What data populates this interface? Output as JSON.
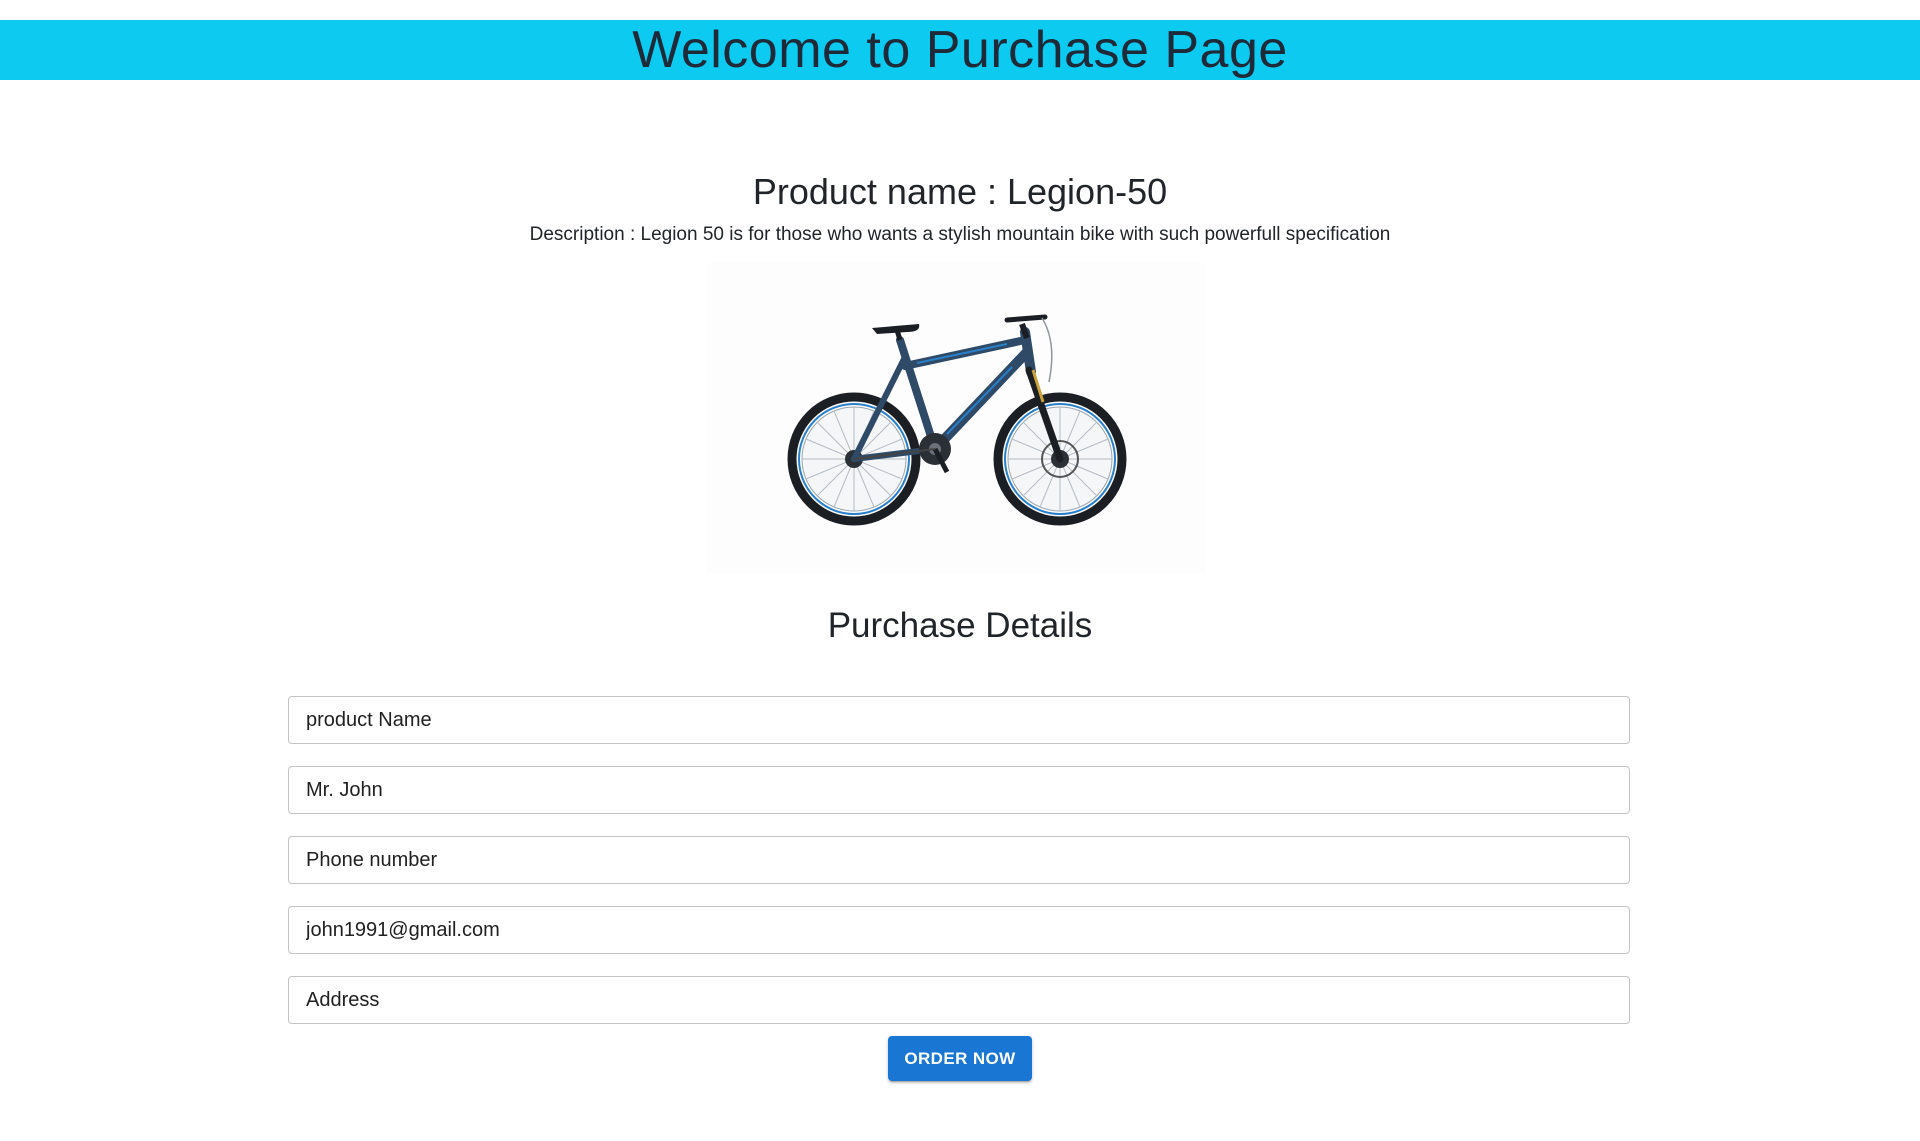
{
  "header": {
    "title": "Welcome to Purchase Page",
    "background_color": "#0dcaf0"
  },
  "product": {
    "name_line": "Product name : Legion-50",
    "description": "Description : Legion 50 is for those who wants a stylish mountain bike with such powerfull specification",
    "image_icon": "mountain-bike-image"
  },
  "form": {
    "title": "Purchase Details",
    "fields": [
      {
        "placeholder": "product Name",
        "value": ""
      },
      {
        "placeholder": "",
        "value": "Mr. John"
      },
      {
        "placeholder": "Phone number",
        "value": ""
      },
      {
        "placeholder": "",
        "value": "john1991@gmail.com"
      },
      {
        "placeholder": "Address",
        "value": ""
      }
    ],
    "submit_label": "ORDER NOW",
    "submit_color": "#1976d2"
  }
}
